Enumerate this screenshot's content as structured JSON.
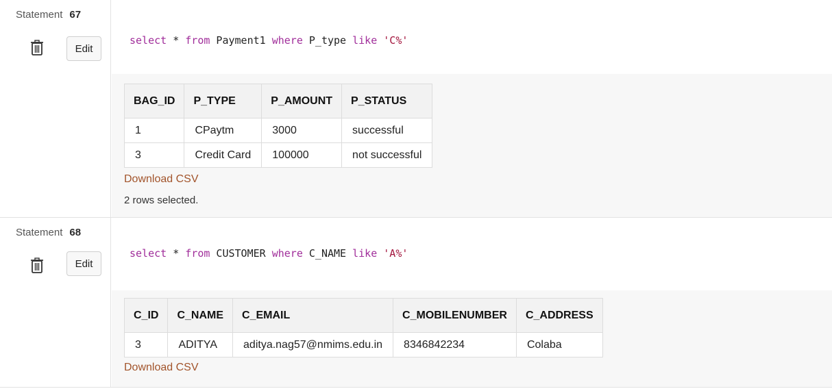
{
  "statements": [
    {
      "label": "Statement",
      "number": "67",
      "edit_label": "Edit",
      "sql": {
        "select": "select",
        "star": " * ",
        "from": "from",
        "table": " Payment1 ",
        "where": "where",
        "column": " P_type ",
        "like": "like",
        "value": " 'C%'"
      },
      "columns": [
        "BAG_ID",
        "P_TYPE",
        "P_AMOUNT",
        "P_STATUS"
      ],
      "rows": [
        [
          "1",
          "CPaytm",
          "3000",
          "successful"
        ],
        [
          "3",
          "Credit Card",
          "100000",
          "not successful"
        ]
      ],
      "download_label": "Download CSV",
      "rows_message": "2 rows selected."
    },
    {
      "label": "Statement",
      "number": "68",
      "edit_label": "Edit",
      "sql": {
        "select": "select",
        "star": " * ",
        "from": "from",
        "table": " CUSTOMER ",
        "where": "where",
        "column": " C_NAME ",
        "like": "like",
        "value": " 'A%'"
      },
      "columns": [
        "C_ID",
        "C_NAME",
        "C_EMAIL",
        "C_MOBILENUMBER",
        "C_ADDRESS"
      ],
      "rows": [
        [
          "3",
          "ADITYA",
          "aditya.nag57@nmims.edu.in",
          "8346842234",
          "Colaba"
        ]
      ],
      "download_label": "Download CSV"
    }
  ]
}
